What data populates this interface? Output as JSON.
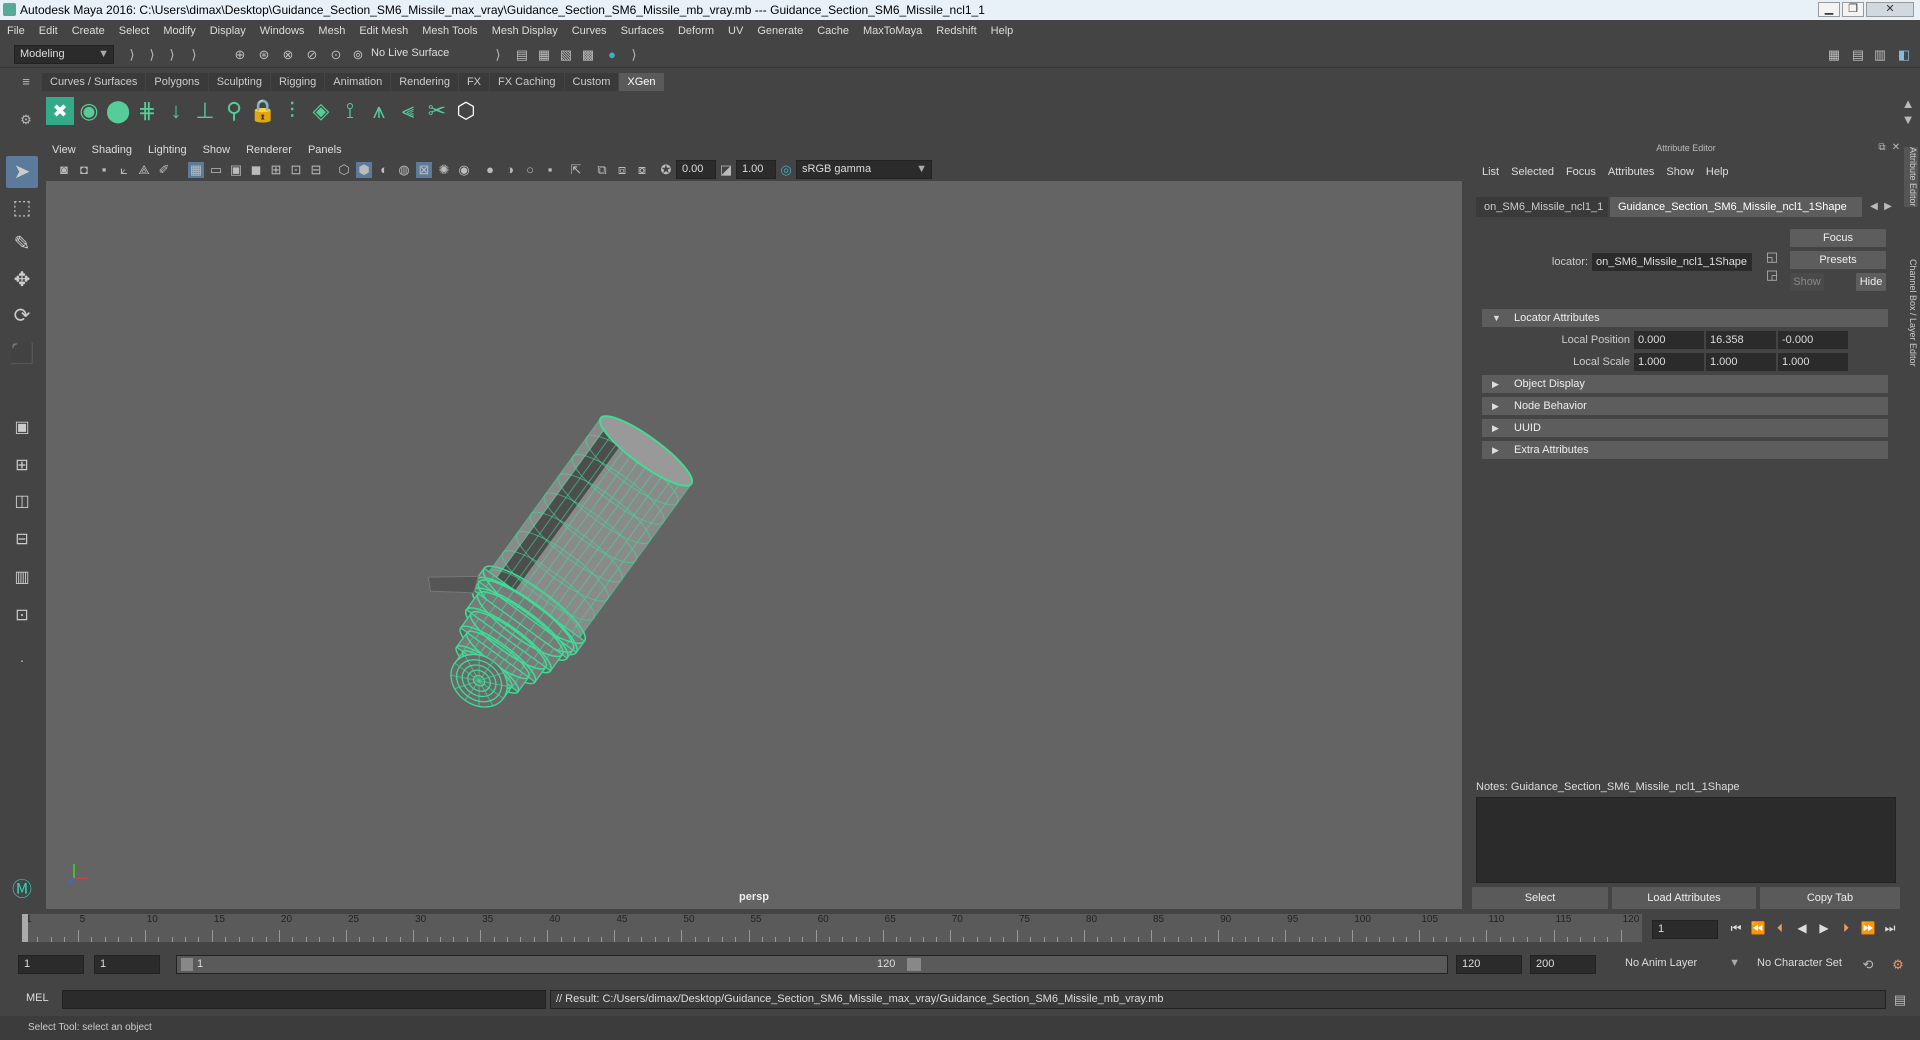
{
  "window": {
    "title": "Autodesk Maya 2016: C:\\Users\\dimax\\Desktop\\Guidance_Section_SM6_Missile_max_vray\\Guidance_Section_SM6_Missile_mb_vray.mb   ---   Guidance_Section_SM6_Missile_ncl1_1",
    "minimize": "▁",
    "maximize": "❐",
    "close": "✕"
  },
  "menubar": [
    "File",
    "Edit",
    "Create",
    "Select",
    "Modify",
    "Display",
    "Windows",
    "Mesh",
    "Edit Mesh",
    "Mesh Tools",
    "Mesh Display",
    "Curves",
    "Surfaces",
    "Deform",
    "UV",
    "Generate",
    "Cache",
    "MaxToMaya",
    "Redshift",
    "Help"
  ],
  "status_line": {
    "mode": "Modeling",
    "live_surface": "No Live Surface"
  },
  "shelf": {
    "tabs": [
      "Curves / Surfaces",
      "Polygons",
      "Sculpting",
      "Rigging",
      "Animation",
      "Rendering",
      "FX",
      "FX Caching",
      "Custom",
      "XGen"
    ],
    "active_tab": "XGen",
    "icons": [
      "xgen-x-icon",
      "xgen-eye-icon",
      "xgen-patch-icon",
      "xgen-grid-icon",
      "xgen-add-icon",
      "xgen-guide-icon",
      "xgen-lasso-icon",
      "xgen-lock-icon",
      "xgen-sculpt-icon",
      "xgen-layer-icon",
      "xgen-cut-icon",
      "xgen-comb-icon",
      "xgen-brush-icon",
      "xgen-scissor-icon",
      "xgen-hex-icon"
    ]
  },
  "viewport": {
    "menus": [
      "View",
      "Shading",
      "Lighting",
      "Show",
      "Renderer",
      "Panels"
    ],
    "exposure": "0.00",
    "gamma": "1.00",
    "color_space": "sRGB gamma",
    "camera": "persp"
  },
  "attribute_editor": {
    "header": "Attribute Editor",
    "menus": [
      "List",
      "Selected",
      "Focus",
      "Attributes",
      "Show",
      "Help"
    ],
    "tabs": [
      "on_SM6_Missile_ncl1_1",
      "Guidance_Section_SM6_Missile_ncl1_1Shape"
    ],
    "locator_label": "locator:",
    "locator_value": "on_SM6_Missile_ncl1_1Shape",
    "focus_btn": "Focus",
    "presets_btn": "Presets",
    "show_btn": "Show",
    "hide_btn": "Hide",
    "sections": {
      "locator": "Locator Attributes",
      "object_display": "Object Display",
      "node_behavior": "Node Behavior",
      "uuid": "UUID",
      "extra": "Extra Attributes"
    },
    "local_position_label": "Local Position",
    "local_position": [
      "0.000",
      "16.358",
      "-0.000"
    ],
    "local_scale_label": "Local Scale",
    "local_scale": [
      "1.000",
      "1.000",
      "1.000"
    ],
    "notes_label": "Notes:  Guidance_Section_SM6_Missile_ncl1_1Shape",
    "buttons": [
      "Select",
      "Load Attributes",
      "Copy Tab"
    ],
    "side_tabs": [
      "Attribute Editor",
      "Channel Box / Layer Editor"
    ]
  },
  "timeline": {
    "ticks": [
      1,
      5,
      10,
      15,
      20,
      25,
      30,
      35,
      40,
      45,
      50,
      55,
      60,
      65,
      70,
      75,
      80,
      85,
      90,
      95,
      100,
      105,
      110,
      115,
      120
    ],
    "current_frame": "1"
  },
  "range": {
    "start": "1",
    "playback_start": "1",
    "slider_start": "1",
    "slider_end": "120",
    "playback_end": "120",
    "end": "200",
    "anim_layer": "No Anim Layer",
    "character_set": "No Character Set"
  },
  "command_line": {
    "label": "MEL",
    "result": "// Result: C:/Users/dimax/Desktop/Guidance_Section_SM6_Missile_max_vray/Guidance_Section_SM6_Missile_mb_vray.mb"
  },
  "help_line": "Select Tool: select an object",
  "colors": {
    "wireframe": "#3ddc97",
    "viewport_bg": "#646464",
    "panel_bg": "#444444"
  }
}
